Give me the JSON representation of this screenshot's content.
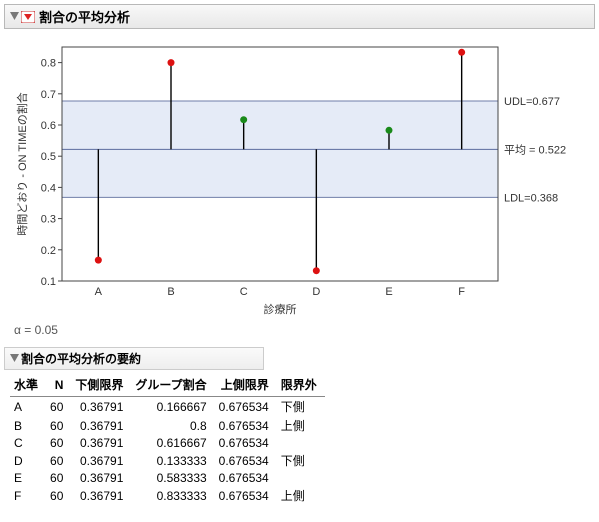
{
  "panel": {
    "title": "割合の平均分析"
  },
  "alpha_label": "α = 0.05",
  "chart_data": {
    "type": "bar",
    "title": "",
    "xlabel": "診療所",
    "ylabel": "時間どおり - ON TIMEの割合",
    "ylim": [
      0.1,
      0.85
    ],
    "mean": 0.522,
    "udl": 0.677,
    "ldl": 0.368,
    "labels": {
      "udl": "UDL=0.677",
      "mean": "平均 = 0.522",
      "ldl": "LDL=0.368"
    },
    "categories": [
      "A",
      "B",
      "C",
      "D",
      "E",
      "F"
    ],
    "values": [
      0.167,
      0.8,
      0.617,
      0.133,
      0.583,
      0.833
    ],
    "outside": [
      true,
      true,
      false,
      true,
      false,
      true
    ]
  },
  "summary": {
    "title": "割合の平均分析の要約",
    "columns": [
      "水準",
      "N",
      "下側限界",
      "グループ割合",
      "上側限界",
      "限界外"
    ],
    "rows": [
      {
        "level": "A",
        "n": 60,
        "lower": "0.36791",
        "prop": "0.166667",
        "upper": "0.676534",
        "out": "下側"
      },
      {
        "level": "B",
        "n": 60,
        "lower": "0.36791",
        "prop": "0.8",
        "upper": "0.676534",
        "out": "上側"
      },
      {
        "level": "C",
        "n": 60,
        "lower": "0.36791",
        "prop": "0.616667",
        "upper": "0.676534",
        "out": ""
      },
      {
        "level": "D",
        "n": 60,
        "lower": "0.36791",
        "prop": "0.133333",
        "upper": "0.676534",
        "out": "下側"
      },
      {
        "level": "E",
        "n": 60,
        "lower": "0.36791",
        "prop": "0.583333",
        "upper": "0.676534",
        "out": ""
      },
      {
        "level": "F",
        "n": 60,
        "lower": "0.36791",
        "prop": "0.833333",
        "upper": "0.676534",
        "out": "上側"
      }
    ]
  }
}
